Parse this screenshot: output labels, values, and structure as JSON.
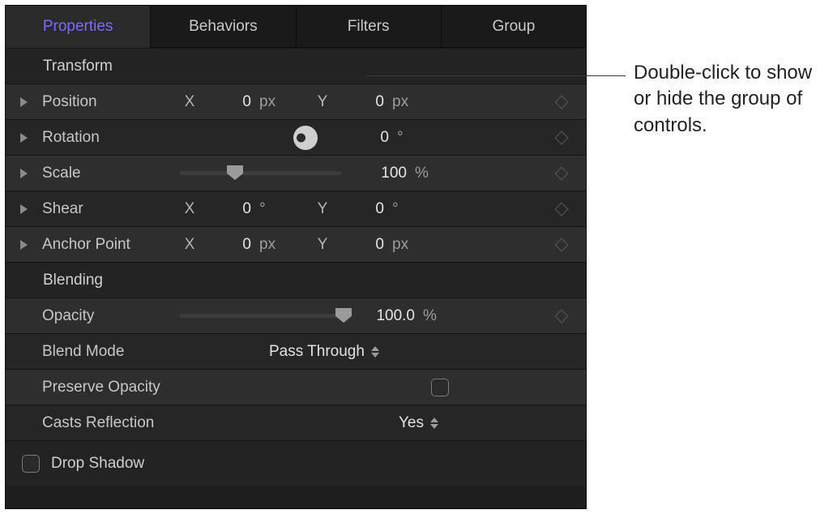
{
  "tabs": [
    "Properties",
    "Behaviors",
    "Filters",
    "Group"
  ],
  "active_tab": 0,
  "sections": {
    "transform": {
      "title": "Transform",
      "position": {
        "label": "Position",
        "x_lbl": "X",
        "x_val": "0",
        "x_unit": "px",
        "y_lbl": "Y",
        "y_val": "0",
        "y_unit": "px"
      },
      "rotation": {
        "label": "Rotation",
        "val": "0",
        "unit": "°"
      },
      "scale": {
        "label": "Scale",
        "val": "100",
        "unit": "%"
      },
      "shear": {
        "label": "Shear",
        "x_lbl": "X",
        "x_val": "0",
        "x_unit": "°",
        "y_lbl": "Y",
        "y_val": "0",
        "y_unit": "°"
      },
      "anchor": {
        "label": "Anchor Point",
        "x_lbl": "X",
        "x_val": "0",
        "x_unit": "px",
        "y_lbl": "Y",
        "y_val": "0",
        "y_unit": "px"
      }
    },
    "blending": {
      "title": "Blending",
      "opacity": {
        "label": "Opacity",
        "val": "100.0",
        "unit": "%"
      },
      "blend_mode": {
        "label": "Blend Mode",
        "val": "Pass Through"
      },
      "preserve": {
        "label": "Preserve Opacity",
        "checked": false
      },
      "casts": {
        "label": "Casts Reflection",
        "val": "Yes"
      }
    },
    "drop_shadow": {
      "title": "Drop Shadow",
      "checked": false
    }
  },
  "callout": "Double-click to show or hide the group of controls."
}
